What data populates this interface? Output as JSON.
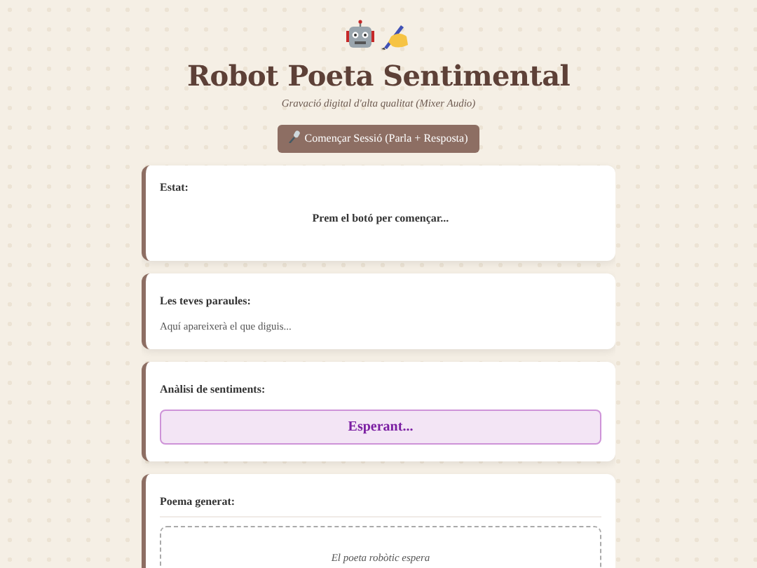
{
  "header": {
    "title": "Robot Poeta Sentimental",
    "subtitle": "Gravació digital d'alta qualitat (Mixer Audio)",
    "start_button": "Començar Sessió (Parla + Resposta)"
  },
  "status": {
    "label": "Estat:",
    "message": "Prem el botó per començar..."
  },
  "words": {
    "label": "Les teves paraules:",
    "text": "Aquí apareixerà el que diguis..."
  },
  "sentiment": {
    "label": "Anàlisi de sentiments:",
    "result": "Esperant..."
  },
  "poem": {
    "label": "Poema generat:",
    "text": "El poeta robòtic espera"
  }
}
